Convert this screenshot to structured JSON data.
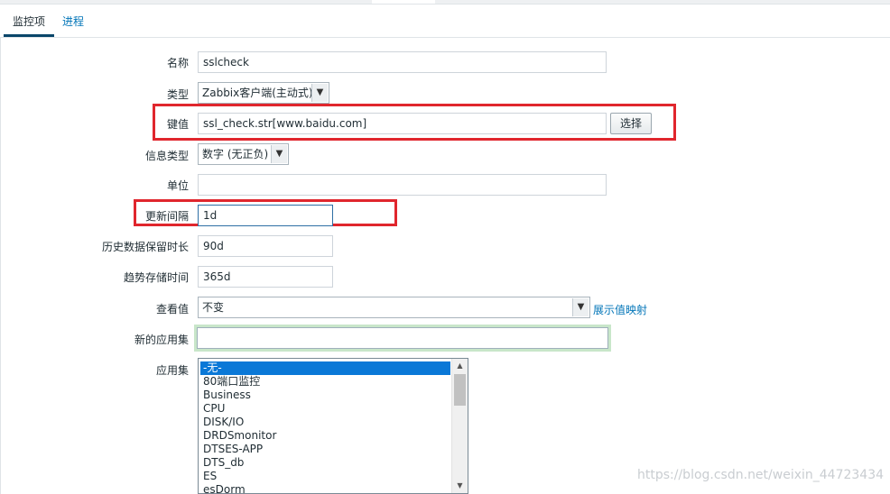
{
  "tabs": [
    {
      "label": "监控项",
      "active": true
    },
    {
      "label": "进程",
      "active": false
    }
  ],
  "form": {
    "name": {
      "label": "名称",
      "value": "sslcheck"
    },
    "type": {
      "label": "类型",
      "value": "Zabbix客户端(主动式)"
    },
    "key": {
      "label": "键值",
      "value": "ssl_check.str[www.baidu.com]",
      "button": "选择"
    },
    "info_type": {
      "label": "信息类型",
      "value": "数字 (无正负)"
    },
    "units": {
      "label": "单位",
      "value": ""
    },
    "update_interval": {
      "label": "更新间隔",
      "value": "1d"
    },
    "history": {
      "label": "历史数据保留时长",
      "value": "90d"
    },
    "trends": {
      "label": "趋势存储时间",
      "value": "365d"
    },
    "show_value": {
      "label": "查看值",
      "value": "不变",
      "link": "展示值映射"
    },
    "new_application": {
      "label": "新的应用集",
      "value": ""
    },
    "applications": {
      "label": "应用集",
      "options": [
        "-无-",
        "80端口监控",
        "Business",
        "CPU",
        "DISK/IO",
        "DRDSmonitor",
        "DTSES-APP",
        "DTS_db",
        "ES",
        "esDorm"
      ],
      "selected": "-无-"
    }
  },
  "watermark": "https://blog.csdn.net/weixin_44723434",
  "colors": {
    "highlight_border": "#e0262d",
    "link": "#0275b8",
    "selection": "#0a78d7"
  }
}
